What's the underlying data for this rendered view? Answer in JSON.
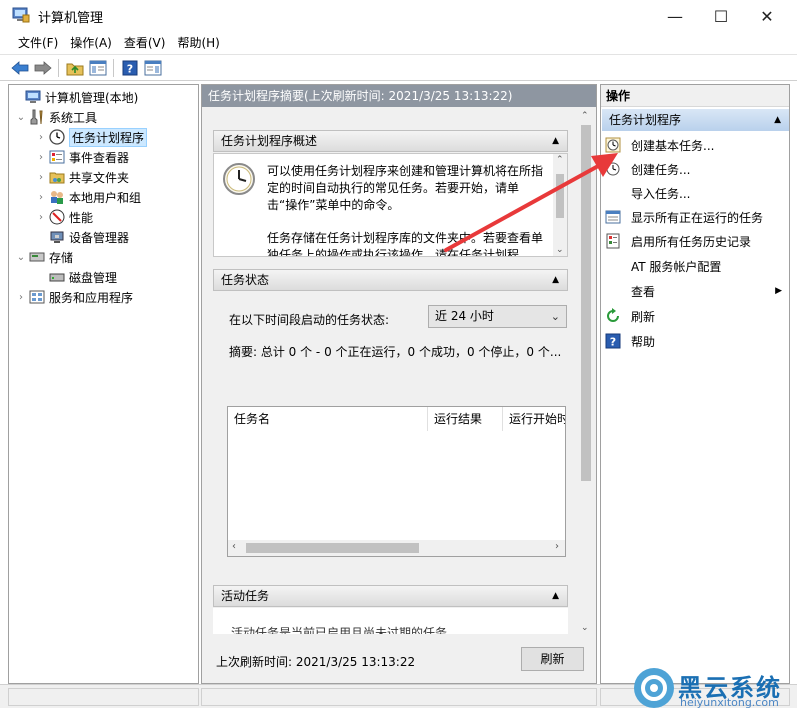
{
  "window": {
    "title": "计算机管理",
    "min": "—",
    "max": "☐",
    "close": "✕"
  },
  "menubar": [
    {
      "label": "文件(F)"
    },
    {
      "label": "操作(A)"
    },
    {
      "label": "查看(V)"
    },
    {
      "label": "帮助(H)"
    }
  ],
  "tree": [
    {
      "label": "计算机管理(本地)",
      "icon": "computer-icon"
    },
    {
      "label": "系统工具",
      "icon": "tools-icon"
    },
    {
      "label": "任务计划程序",
      "icon": "clock-icon"
    },
    {
      "label": "事件查看器",
      "icon": "event-viewer-icon"
    },
    {
      "label": "共享文件夹",
      "icon": "shared-folder-icon"
    },
    {
      "label": "本地用户和组",
      "icon": "users-icon"
    },
    {
      "label": "性能",
      "icon": "performance-icon"
    },
    {
      "label": "设备管理器",
      "icon": "device-manager-icon"
    },
    {
      "label": "存储",
      "icon": "storage-icon"
    },
    {
      "label": "磁盘管理",
      "icon": "disk-icon"
    },
    {
      "label": "服务和应用程序",
      "icon": "services-icon"
    }
  ],
  "middle": {
    "header": "任务计划程序摘要(上次刷新时间: 2021/3/25 13:13:22)",
    "overview": {
      "title": "任务计划程序概述",
      "line1": "可以使用任务计划程序来创建和管理计算机将在所指定的时间自动执行的常见任务。若要开始，请单击“操作”菜单中的命令。",
      "line2": "任务存储在任务计划程序库的文件夹中。若要查看单独任务上的操作或执行该操作，请在任务计划程"
    },
    "status": {
      "title": "任务状态",
      "filter_label": "在以下时间段启动的任务状态:",
      "filter_value": "近 24 小时",
      "summary": "摘要: 总计 0 个 - 0 个正在运行，0 个成功，0 个停止，0 个...",
      "columns": [
        "任务名",
        "运行结果",
        "运行开始时"
      ]
    },
    "active": {
      "title": "活动任务",
      "partial_text": "活动任务是当前已启用且尚未过期的任务。"
    },
    "footer": {
      "last_refresh": "上次刷新时间: 2021/3/25 13:13:22",
      "refresh_button": "刷新"
    }
  },
  "actions": {
    "header": "操作",
    "section": "任务计划程序",
    "items": [
      {
        "label": "创建基本任务...",
        "icon": "basic-task-icon"
      },
      {
        "label": "创建任务...",
        "icon": "create-task-icon"
      },
      {
        "label": "导入任务...",
        "icon": ""
      },
      {
        "label": "显示所有正在运行的任务",
        "icon": "running-tasks-icon"
      },
      {
        "label": "启用所有任务历史记录",
        "icon": "history-icon"
      },
      {
        "label": "AT 服务帐户配置",
        "icon": ""
      },
      {
        "label": "查看",
        "icon": ""
      },
      {
        "label": "刷新",
        "icon": "refresh-icon"
      },
      {
        "label": "帮助",
        "icon": "help-icon"
      }
    ]
  },
  "watermark": {
    "title": "黑云系统",
    "url": "heiyunxitong.com"
  },
  "colors": {
    "accent": "#1e6fc2",
    "selection": "#cce8ff",
    "arrow": "#e8393a"
  }
}
